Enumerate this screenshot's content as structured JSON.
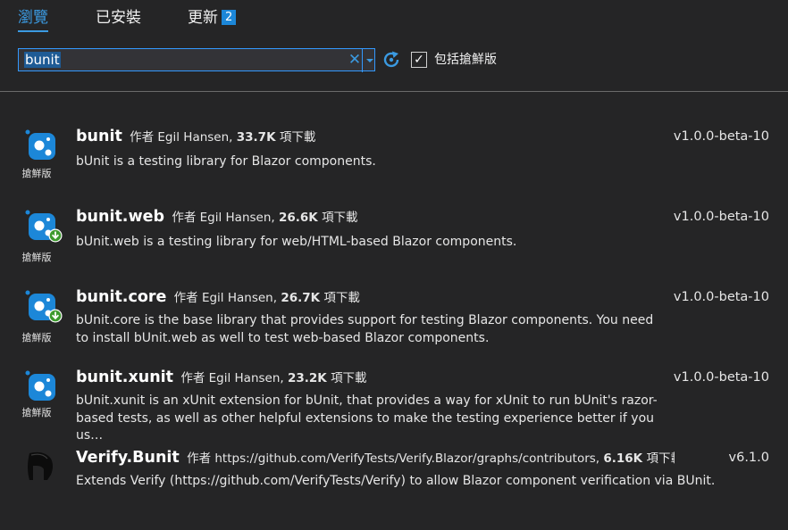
{
  "tabs": {
    "browse": "瀏覽",
    "installed": "已安裝",
    "updates": "更新",
    "updates_count": "2"
  },
  "search": {
    "value": "bunit",
    "include_prerelease_label": "包括搶鮮版",
    "include_prerelease_checked": true
  },
  "colors": {
    "accent": "#3b9ae1",
    "background": "#252526",
    "icon_blue": "#1c87d8",
    "install_green": "#3c9a2e"
  },
  "packages": [
    {
      "name": "bunit",
      "by_label": "作者",
      "author": "Egil Hansen,",
      "downloads": "33.7K",
      "downloads_label": "項下載",
      "description": "bUnit is a testing library for Blazor components.",
      "version": "v1.0.0-beta-10",
      "prerelease_label": "搶鮮版",
      "icon": "nuget-package-icon",
      "installed": false
    },
    {
      "name": "bunit.web",
      "by_label": "作者",
      "author": "Egil Hansen,",
      "downloads": "26.6K",
      "downloads_label": "項下載",
      "description": "bUnit.web is a testing library for web/HTML-based Blazor components.",
      "version": "v1.0.0-beta-10",
      "prerelease_label": "搶鮮版",
      "icon": "nuget-package-icon",
      "installed": true
    },
    {
      "name": "bunit.core",
      "by_label": "作者",
      "author": "Egil Hansen,",
      "downloads": "26.7K",
      "downloads_label": "項下載",
      "description": "bUnit.core is the base library that provides support for testing Blazor components. You need to install bUnit.web as well to test web-based Blazor components.",
      "version": "v1.0.0-beta-10",
      "prerelease_label": "搶鮮版",
      "icon": "nuget-package-icon",
      "installed": true
    },
    {
      "name": "bunit.xunit",
      "by_label": "作者",
      "author": "Egil Hansen,",
      "downloads": "23.2K",
      "downloads_label": "項下載",
      "description": "bUnit.xunit is an xUnit extension for bUnit, that provides a way for xUnit to run bUnit's razor-based tests, as well as other helpful extensions to make the testing experience better if you us…",
      "version": "v1.0.0-beta-10",
      "prerelease_label": "搶鮮版",
      "icon": "nuget-package-icon",
      "installed": false
    },
    {
      "name": "Verify.Bunit",
      "by_label": "作者",
      "author": "https://github.com/VerifyTests/Verify.Blazor/graphs/contributors,",
      "downloads": "6.16K",
      "downloads_label": "項下載",
      "description": "Extends Verify (https://github.com/VerifyTests/Verify) to allow Blazor component verification via BUnit.",
      "version": "v6.1.0",
      "prerelease_label": "",
      "icon": "spartan-helmet-icon",
      "installed": false
    }
  ]
}
